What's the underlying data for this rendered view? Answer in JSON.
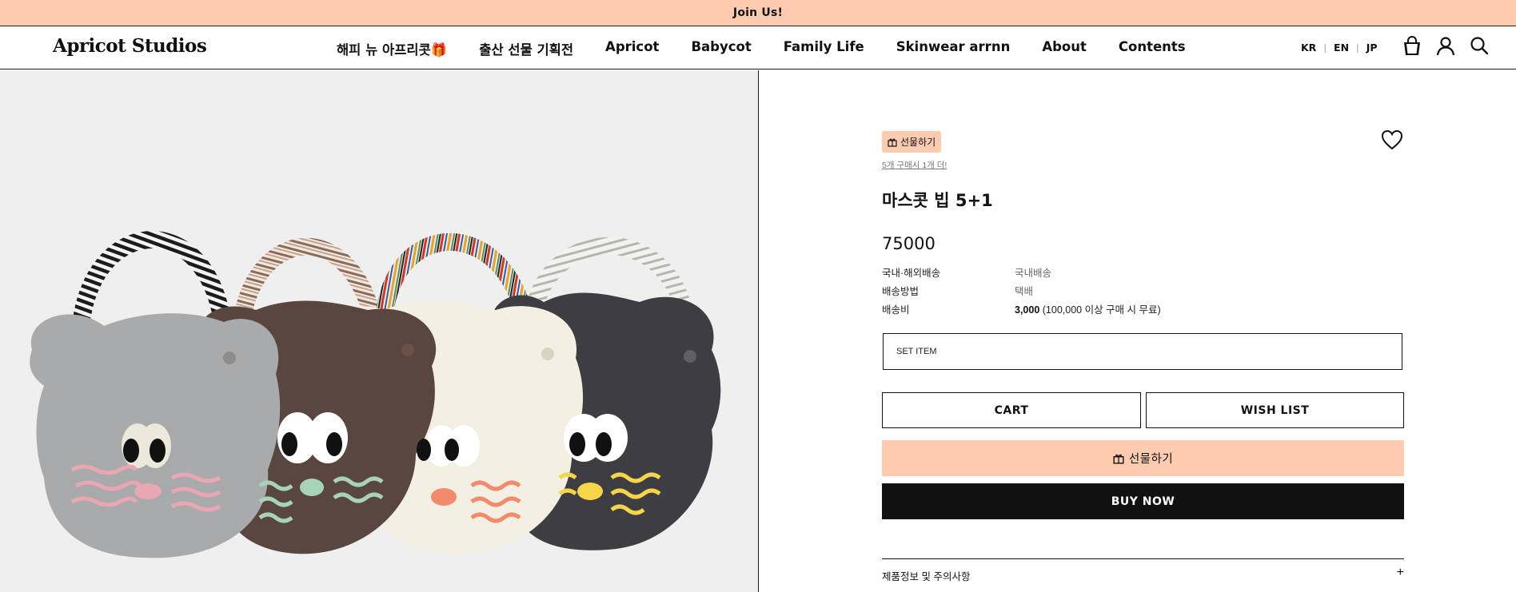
{
  "announcement": {
    "text": "Join Us!"
  },
  "header": {
    "logo": "Apricot Studios",
    "nav": [
      "해피 뉴 아프리콧🎁",
      "출산 선물 기획전",
      "Apricot",
      "Babycot",
      "Family Life",
      "Skinwear arrnn",
      "About",
      "Contents"
    ],
    "languages": [
      "KR",
      "EN",
      "JP"
    ],
    "icons": [
      "cart-icon",
      "account-icon",
      "search-icon"
    ]
  },
  "product": {
    "gift_tag": "선물하기",
    "promo": "5개 구매시 1개 더!",
    "title": "마스콧 빕 5+1",
    "price": "75000",
    "specs": [
      {
        "label": "국내·해외배송",
        "value": "국내배송"
      },
      {
        "label": "배송방법",
        "value": "택배"
      },
      {
        "label": "배송비",
        "value_bold": "3,000",
        "value_note": " (100,000 이상 구매 시 무료)"
      }
    ],
    "option_select": "SET ITEM",
    "cart_label": "CART",
    "wishlist_label": "WISH LIST",
    "gift_button_label": "선물하기",
    "buy_now_label": "BUY NOW",
    "accordion_label": "제품정보 및 주의사항"
  },
  "colors": {
    "accent": "#fdcbb0",
    "dark": "#111111",
    "image_bg": "#efeff0"
  }
}
